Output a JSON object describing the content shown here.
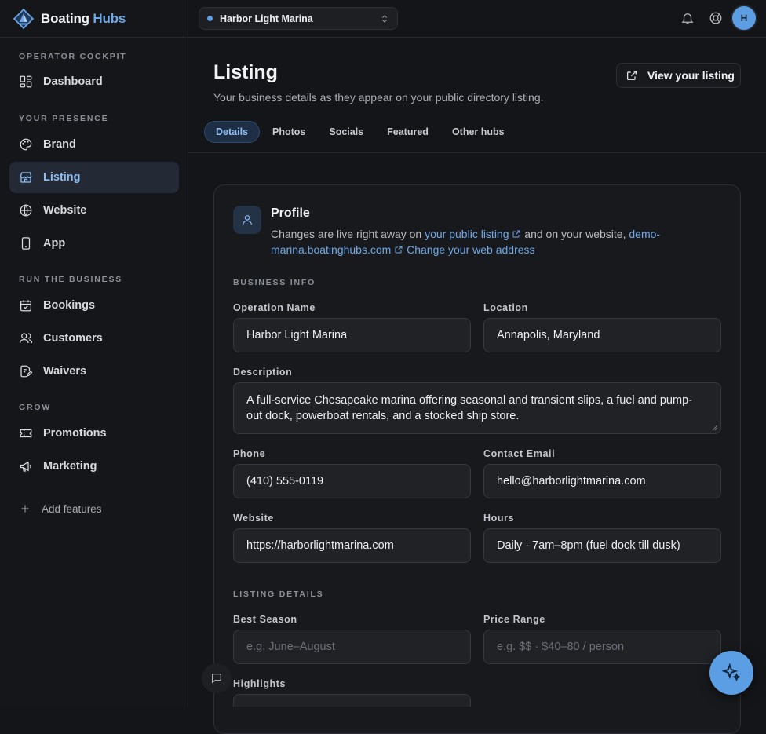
{
  "brand": {
    "name_part1": "Boating",
    "name_part2": " Hubs"
  },
  "workspace": {
    "name": "Harbor Light Marina"
  },
  "user": {
    "initial": "H"
  },
  "sidebar": {
    "sections": [
      "OPERATOR COCKPIT",
      "YOUR PRESENCE",
      "RUN THE BUSINESS",
      "GROW"
    ],
    "items": [
      {
        "label": "Dashboard",
        "icon": "dashboard-icon"
      },
      {
        "label": "Brand",
        "icon": "palette-icon"
      },
      {
        "label": "Listing",
        "icon": "storefront-icon",
        "active": true
      },
      {
        "label": "Website",
        "icon": "globe-icon"
      },
      {
        "label": "App",
        "icon": "phone-icon"
      },
      {
        "label": "Bookings",
        "icon": "calendar-icon"
      },
      {
        "label": "Customers",
        "icon": "users-icon"
      },
      {
        "label": "Waivers",
        "icon": "waiver-icon"
      },
      {
        "label": "Promotions",
        "icon": "ticket-icon"
      },
      {
        "label": "Marketing",
        "icon": "megaphone-icon"
      }
    ],
    "add_features": "Add features"
  },
  "page": {
    "title": "Listing",
    "subtitle": "Your business details as they appear on your public directory listing.",
    "view_button": "View your listing",
    "tabs": [
      "Details",
      "Photos",
      "Socials",
      "Featured",
      "Other hubs"
    ]
  },
  "profile": {
    "title": "Profile",
    "desc_1": "Changes are live right away on ",
    "link_listing": "your public listing",
    "desc_2": " and on your website, ",
    "link_site": "demo-marina.boatinghubs.com",
    "link_change": "Change your web address"
  },
  "form": {
    "group_business": "BUSINESS INFO",
    "group_listing": "LISTING DETAILS",
    "operation_name_label": "Operation Name",
    "operation_name": "Harbor Light Marina",
    "location_label": "Location",
    "location": "Annapolis, Maryland",
    "description_label": "Description",
    "description": "A full-service Chesapeake marina offering seasonal and transient slips, a fuel and pump-out dock, powerboat rentals, and a stocked ship store.",
    "phone_label": "Phone",
    "phone": "(410) 555-0119",
    "email_label": "Contact Email",
    "email": "hello@harborlightmarina.com",
    "website_label": "Website",
    "website": "https://harborlightmarina.com",
    "hours_label": "Hours",
    "hours": "Daily · 7am–8pm (fuel dock till dusk)",
    "season_label": "Best Season",
    "season_placeholder": "e.g. June–August",
    "price_label": "Price Range",
    "price_placeholder": "e.g. $$ · $40–80 / person",
    "highlights_label": "Highlights"
  },
  "colors": {
    "accent": "#5b9ee3",
    "link": "#6ea8e6",
    "background": "#141518"
  }
}
